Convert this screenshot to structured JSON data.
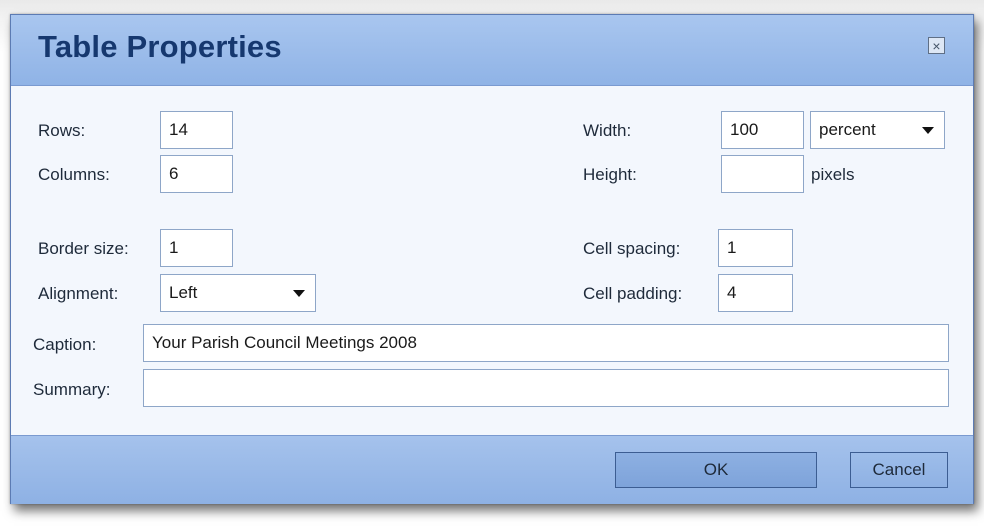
{
  "dialog": {
    "title": "Table Properties",
    "close_symbol": "×",
    "close_icon": "close-x-icon"
  },
  "fields": {
    "rows": {
      "label": "Rows:",
      "value": "14"
    },
    "columns": {
      "label": "Columns:",
      "value": "6"
    },
    "width": {
      "label": "Width:",
      "value": "100",
      "unit": "percent"
    },
    "height": {
      "label": "Height:",
      "value": "",
      "unit": "pixels"
    },
    "border_size": {
      "label": "Border size:",
      "value": "1"
    },
    "alignment": {
      "label": "Alignment:",
      "value": "Left"
    },
    "cell_spacing": {
      "label": "Cell spacing:",
      "value": "1"
    },
    "cell_padding": {
      "label": "Cell padding:",
      "value": "4"
    },
    "caption": {
      "label": "Caption:",
      "value": "Your Parish Council Meetings 2008"
    },
    "summary": {
      "label": "Summary:",
      "value": ""
    }
  },
  "buttons": {
    "ok": "OK",
    "cancel": "Cancel"
  },
  "colors": {
    "title_text": "#16386f",
    "title_bar": "#a9c6ef",
    "body": "#f3f7fd",
    "footer": "#8eb1e4"
  }
}
